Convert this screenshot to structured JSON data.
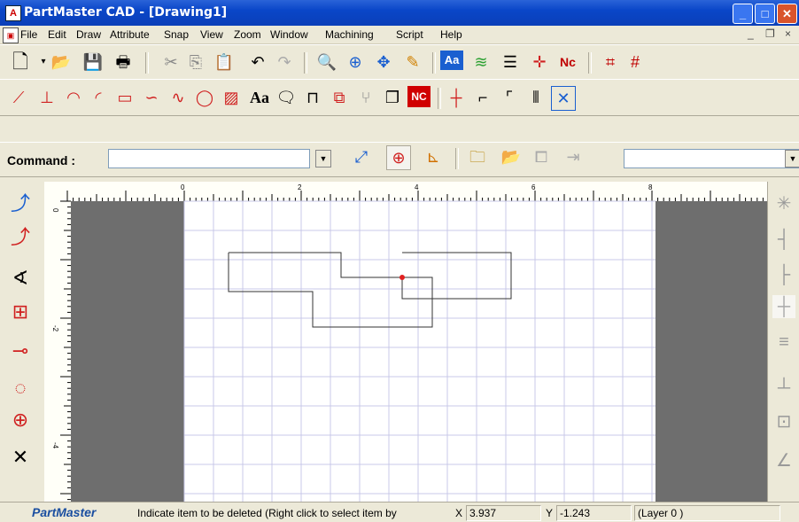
{
  "window": {
    "title": "PartMaster CAD - [Drawing1]",
    "app_icon": "compass-icon"
  },
  "menu": {
    "items": [
      "File",
      "Edit",
      "Draw",
      "Attribute",
      "Snap",
      "View",
      "Zoom",
      "Window",
      "Machining",
      "Script",
      "Help"
    ],
    "mdi_controls": [
      "_",
      "❐",
      "×"
    ]
  },
  "toolbar_standard": [
    "new-document-icon",
    "open-folder-icon",
    "save-icon",
    "print-icon",
    "cut-icon",
    "copy-icon",
    "paste-icon",
    "undo-icon",
    "redo-icon",
    "zoom-icon",
    "zoom-in-icon",
    "pan-icon",
    "edit-pencil-icon",
    "text-style-icon",
    "layers-icon",
    "line-style-icon",
    "crosshair-icon",
    "nc-icon",
    "grid-icon",
    "grid-dim-icon"
  ],
  "toolbar_draw": [
    "line-icon",
    "line-perp-icon",
    "arc-icon",
    "arc-tangent-icon",
    "rectangle-icon",
    "polyline-icon",
    "spline-icon",
    "circle-icon",
    "hatch-icon",
    "text-icon",
    "note-icon",
    "dimension-icon",
    "block-icon",
    "tree-icon",
    "copy-obj-icon",
    "nc-program-icon",
    "cross-snap-icon",
    "corner-icon",
    "fillet-icon",
    "break-icon",
    "disable-snap-icon"
  ],
  "command": {
    "label": "Command :",
    "value": ""
  },
  "toolbar_command_icons": [
    "snap-point-icon",
    "target-icon",
    "coordinate-icon",
    "open-file-icon",
    "open-folder-icon",
    "network-icon",
    "import-icon"
  ],
  "left_tools": [
    "snap-endpoint-icon",
    "snap-midpoint-icon",
    "snap-angle-icon",
    "snap-grid-icon",
    "snap-center-icon",
    "snap-circle-icon",
    "snap-quadrant-icon",
    "snap-intersection-icon"
  ],
  "right_tools": [
    "cross-icon",
    "align-left-icon",
    "align-right-icon",
    "align-center-icon",
    "equal-icon",
    "vertical-icon",
    "frame-icon",
    "angle-icon"
  ],
  "ruler": {
    "h_labels": [
      "0",
      "2",
      "4",
      "6",
      "8"
    ],
    "v_labels": [
      "0",
      "-2",
      "-4"
    ]
  },
  "colors": {
    "titlebar": "#0a46c8",
    "sheet_margin": "#6e6e6e",
    "grid": "#c8c8e8",
    "shape": "#333333",
    "marker": "#e02020"
  },
  "status": {
    "brand": "PartMaster",
    "message": "Indicate item to be deleted (Right click to select item by",
    "x_label": "X",
    "x_value": "3.937",
    "y_label": "Y",
    "y_value": "-1.243",
    "layer": "(Layer 0 )"
  }
}
